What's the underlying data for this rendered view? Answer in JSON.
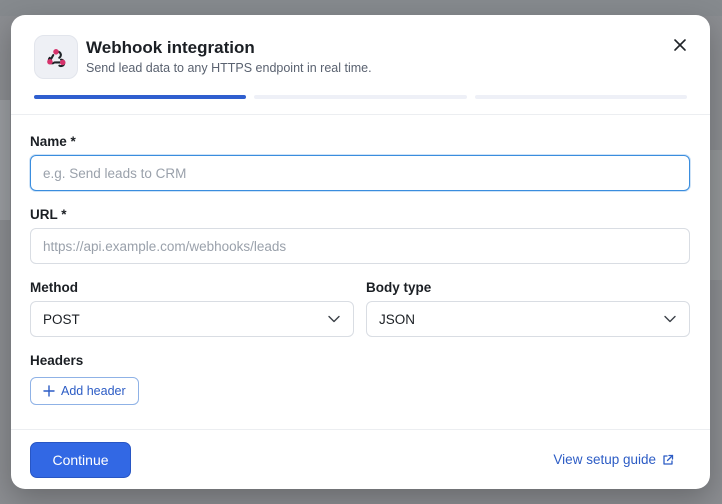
{
  "dialog": {
    "title": "Webhook integration",
    "subtitle": "Send lead data to any HTTPS endpoint in real time.",
    "icon": "webhook-icon",
    "close_icon": "close-icon",
    "steps_total": 3,
    "steps_active": 1
  },
  "form": {
    "name": {
      "label": "Name *",
      "placeholder": "e.g. Send leads to CRM",
      "value": ""
    },
    "url": {
      "label": "URL *",
      "placeholder": "https://api.example.com/webhooks/leads",
      "value": ""
    },
    "method": {
      "label": "Method",
      "value": "POST"
    },
    "body_type": {
      "label": "Body type",
      "value": "JSON"
    },
    "headers": {
      "label": "Headers",
      "add_label": "Add header"
    }
  },
  "footer": {
    "continue_label": "Continue",
    "guide_label": "View setup guide",
    "guide_icon": "external-link-icon"
  },
  "colors": {
    "accent": "#3268e4",
    "link": "#2c5cc5",
    "progress_active": "#2f5fcf",
    "progress_inactive": "#eef0f7",
    "focus_border": "#3a8dde"
  }
}
